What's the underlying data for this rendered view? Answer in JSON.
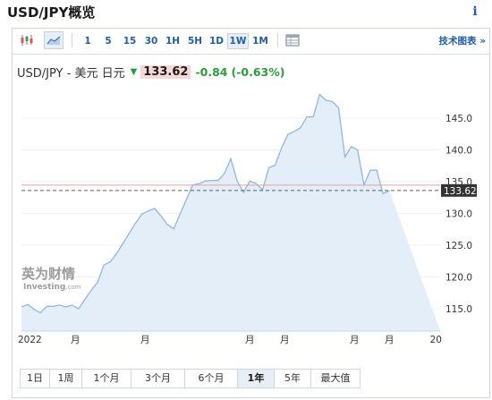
{
  "header": {
    "title": "USD/JPY概览",
    "info_label": "i"
  },
  "toolbar": {
    "chart_types": [
      {
        "icon": "candlestick-icon",
        "selected": false
      },
      {
        "icon": "area-chart-icon",
        "selected": true
      }
    ],
    "intervals": [
      {
        "label": "1",
        "selected": false
      },
      {
        "label": "5",
        "selected": false
      },
      {
        "label": "15",
        "selected": false
      },
      {
        "label": "30",
        "selected": false
      },
      {
        "label": "1H",
        "selected": false
      },
      {
        "label": "5H",
        "selected": false
      },
      {
        "label": "1D",
        "selected": false
      },
      {
        "label": "1W",
        "selected": true
      },
      {
        "label": "1M",
        "selected": false
      }
    ],
    "table_icon": "table-icon",
    "technical_label": "技术图表 »"
  },
  "quote": {
    "pair": "USD/JPY - 美元 日元",
    "direction_icon": "down-arrow-icon",
    "price": "133.62",
    "change": "-0.84",
    "change_pct": "(-0.63%)"
  },
  "watermark": {
    "main": "英为财情",
    "sub": "Investing",
    "suffix": ".com"
  },
  "range_buttons": [
    {
      "label": "1日",
      "selected": false
    },
    {
      "label": "1周",
      "selected": false
    },
    {
      "label": "1个月",
      "selected": false
    },
    {
      "label": "3个月",
      "selected": false
    },
    {
      "label": "6个月",
      "selected": false
    },
    {
      "label": "1年",
      "selected": true
    },
    {
      "label": "5年",
      "selected": false
    },
    {
      "label": "最大值",
      "selected": false
    }
  ],
  "colors": {
    "line": "#8fb8de",
    "fill": "#e3eef8",
    "last_price_bg": "#333333",
    "previous_close_line": "#e8a0a0",
    "up_green": "#2a9d3a",
    "link_blue": "#1f5fa8"
  },
  "chart_data": {
    "type": "area",
    "title": "",
    "xlabel": "",
    "ylabel": "",
    "ylim": [
      111.5,
      149.5
    ],
    "y_ticks": [
      115.0,
      120.0,
      125.0,
      130.0,
      135.0,
      140.0,
      145.0
    ],
    "x_tick_labels": [
      "2022",
      "月",
      "月",
      "月",
      "月",
      "月",
      "月",
      "20"
    ],
    "x_tick_positions": [
      0.0,
      8.5,
      19.5,
      36.0,
      41.5,
      52.5,
      58.0,
      67.0
    ],
    "last_price": 133.62,
    "last_price_label": "133.62",
    "previous_close": 134.46,
    "x": [
      0,
      1,
      2,
      3,
      4,
      5,
      6,
      7,
      8,
      9,
      10,
      11,
      12,
      13,
      14,
      15,
      16,
      17,
      18,
      19,
      20,
      21,
      22,
      23,
      24,
      25,
      26,
      27,
      28,
      29,
      30,
      31,
      32,
      33,
      34,
      35,
      36,
      37,
      38,
      39,
      40,
      41,
      42,
      43,
      44,
      45,
      46,
      47,
      48,
      49,
      50,
      51,
      52,
      53,
      54,
      55,
      56,
      57,
      58,
      59,
      60,
      61,
      62,
      63,
      64,
      65,
      66
    ],
    "values": [
      115.3,
      115.7,
      114.9,
      114.4,
      115.4,
      115.4,
      115.6,
      115.3,
      115.6,
      115.0,
      116.5,
      117.9,
      119.2,
      121.9,
      122.4,
      123.7,
      125.3,
      126.9,
      128.5,
      129.9,
      130.4,
      130.8,
      129.6,
      128.3,
      127.6,
      129.9,
      132.2,
      134.5,
      134.7,
      135.1,
      135.2,
      135.2,
      136.3,
      138.6,
      135.1,
      133.3,
      135.1,
      134.7,
      133.7,
      137.2,
      137.6,
      140.3,
      142.4,
      142.9,
      143.5,
      145.2,
      145.2,
      148.7,
      147.8,
      147.6,
      146.6,
      138.9,
      140.5,
      140.0,
      134.5,
      136.8,
      136.8,
      133.1,
      133.6
    ]
  }
}
